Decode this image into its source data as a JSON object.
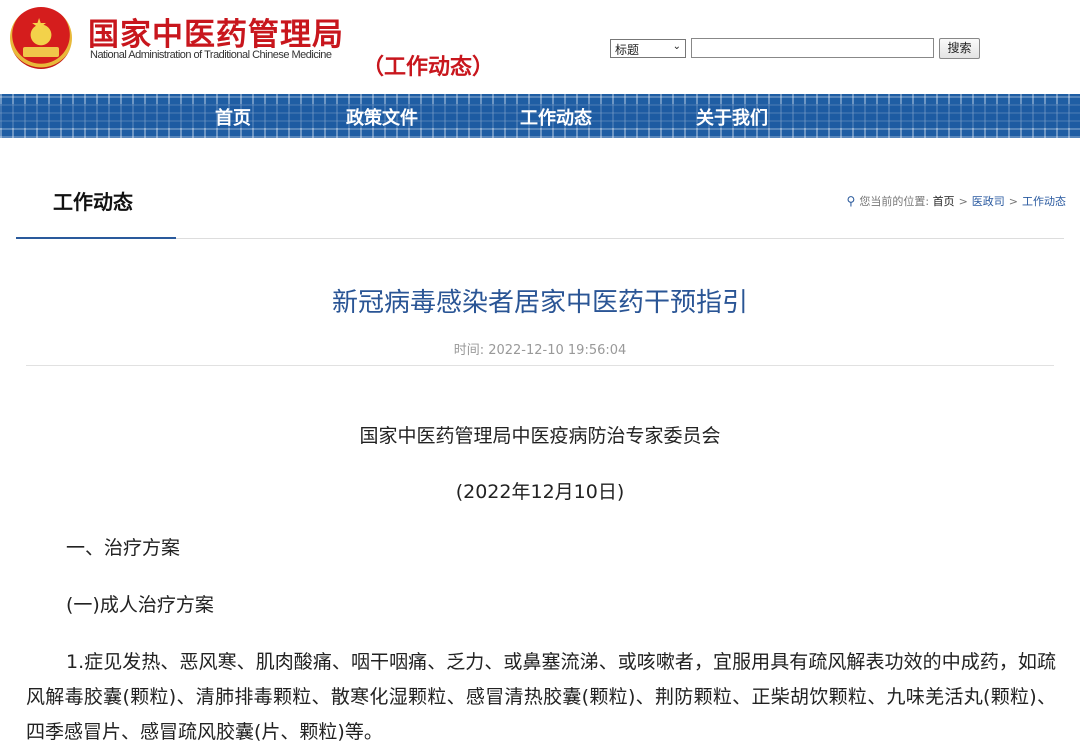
{
  "header": {
    "site_name_cn": "国家中医药管理局",
    "site_name_en": "National Administration of Traditional Chinese Medicine",
    "section_tag": "（工作动态）",
    "search": {
      "select_value": "标题",
      "input_value": "",
      "button_label": "搜索"
    }
  },
  "nav": {
    "items": [
      "首页",
      "政策文件",
      "工作动态",
      "关于我们"
    ]
  },
  "subheader": {
    "title": "工作动态",
    "breadcrumb_prefix": "您当前的位置:",
    "breadcrumb": [
      "首页",
      "医政司",
      "工作动态"
    ],
    "separator": ">"
  },
  "article": {
    "title": "新冠病毒感染者居家中医药干预指引",
    "time_label": "时间:",
    "time_value": "2022-12-10 19:56:04",
    "author_line": "国家中医药管理局中医疫病防治专家委员会",
    "date_line": "(2022年12月10日)",
    "heading1": "一、治疗方案",
    "heading2": "(一)成人治疗方案",
    "para1": "1.症见发热、恶风寒、肌肉酸痛、咽干咽痛、乏力、或鼻塞流涕、或咳嗽者，宜服用具有疏风解表功效的中成药，如疏风解毒胶囊(颗粒)、清肺排毒颗粒、散寒化湿颗粒、感冒清热胶囊(颗粒)、荆防颗粒、正柴胡饮颗粒、九味羌活丸(颗粒)、四季感冒片、感冒疏风胶囊(片、颗粒)等。"
  },
  "colors": {
    "brand_red": "#c8161d",
    "nav_blue": "#1f5ea4",
    "title_blue": "#2a5595"
  }
}
